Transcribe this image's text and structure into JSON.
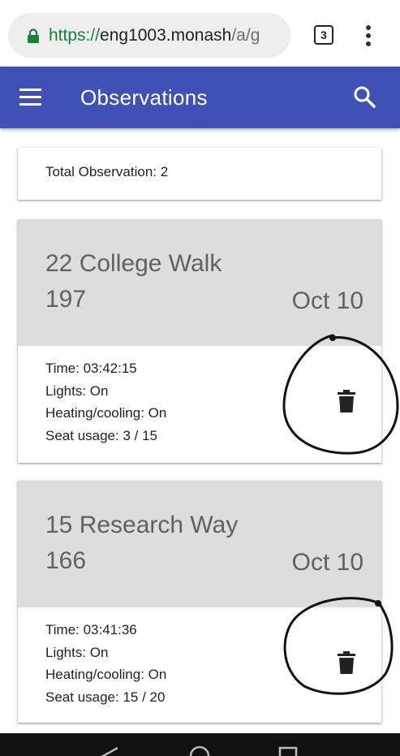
{
  "browser": {
    "url_scheme": "https://",
    "url_host": "eng1003.monash",
    "url_path": "/a/g",
    "tab_count": "3"
  },
  "app_bar": {
    "title": "Observations",
    "color": "#3f51b5",
    "menu_icon": "menu-icon",
    "search_icon": "search-icon"
  },
  "summary": {
    "text": "Total Observation: 2"
  },
  "observations": [
    {
      "address": "22 College Walk",
      "room": "197",
      "date": "Oct 10",
      "time": "Time: 03:42:15",
      "lights": "Lights: On",
      "heating": "Heating/cooling: On",
      "seats": "Seat usage: 3 / 15",
      "delete_icon": "trash-icon"
    },
    {
      "address": "15 Research Way",
      "room": "166",
      "date": "Oct 10",
      "time": "Time: 03:41:36",
      "lights": "Lights: On",
      "heating": "Heating/cooling: On",
      "seats": "Seat usage: 15 / 20",
      "delete_icon": "trash-icon"
    }
  ]
}
